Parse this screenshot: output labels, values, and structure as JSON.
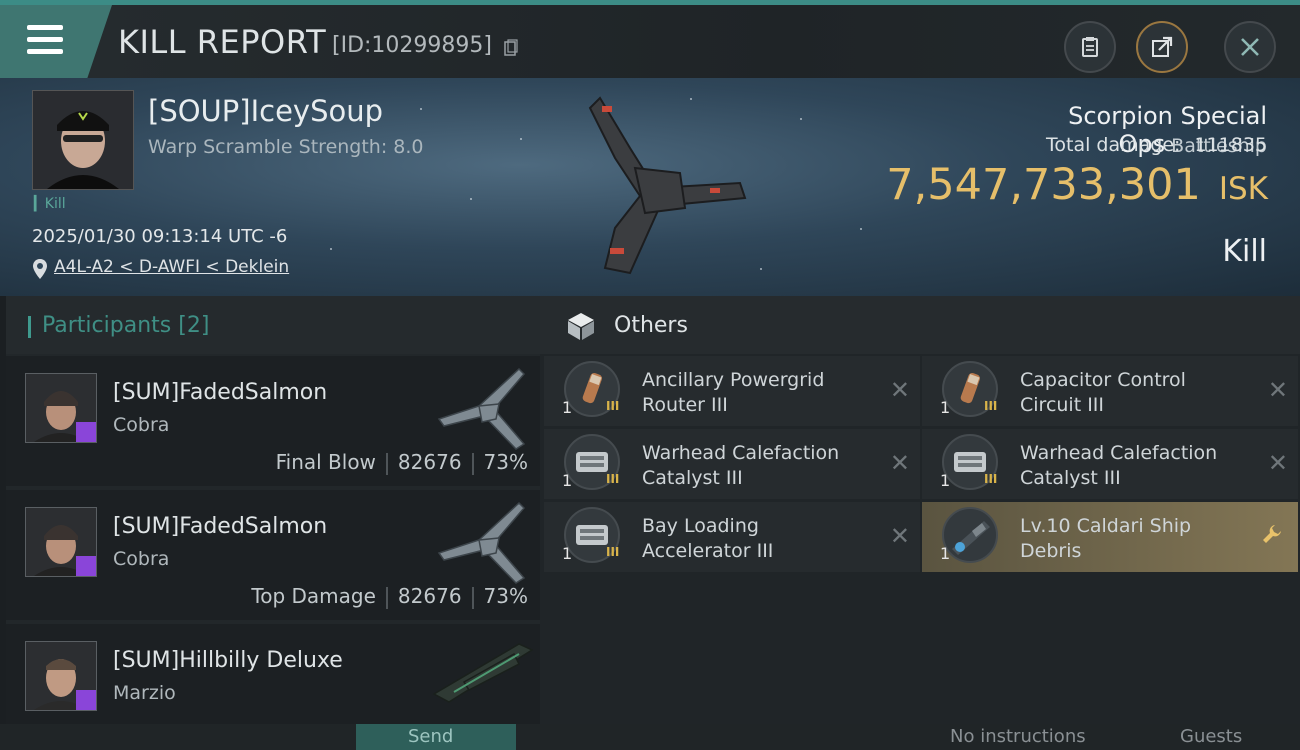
{
  "header": {
    "title": "KILL REPORT",
    "report_id": "[ID:10299895]"
  },
  "victim": {
    "name": "[SOUP]IceySoup",
    "warp_scramble": "Warp Scramble Strength: 8.0",
    "kill_tag": "Kill",
    "timestamp": "2025/01/30 09:13:14 UTC -6",
    "location": "A4L-A2 < D-AWFI < Deklein",
    "ship_name": "Scorpion Special Ops",
    "ship_class": "Battleship",
    "damage_label": "Total damage:",
    "total_damage": "111835",
    "isk_value": "7,547,733,301",
    "isk_unit": "ISK",
    "result": "Kill"
  },
  "participants": {
    "title": "Participants",
    "count": "[2]",
    "rows": [
      {
        "name": "[SUM]FadedSalmon",
        "ship": "Cobra",
        "role": "Final Blow",
        "damage": "82676",
        "percent": "73%"
      },
      {
        "name": "[SUM]FadedSalmon",
        "ship": "Cobra",
        "role": "Top Damage",
        "damage": "82676",
        "percent": "73%"
      },
      {
        "name": "[SUM]Hillbilly Deluxe",
        "ship": "Marzio",
        "role": "",
        "damage": "",
        "percent": ""
      }
    ]
  },
  "others": {
    "title": "Others",
    "items": [
      {
        "name": "Ancillary Powergrid Router III",
        "qty": "1",
        "meta": "III"
      },
      {
        "name": "Capacitor Control Circuit III",
        "qty": "1",
        "meta": "III"
      },
      {
        "name": "Warhead Calefaction Catalyst III",
        "qty": "1",
        "meta": "III"
      },
      {
        "name": "Warhead Calefaction Catalyst III",
        "qty": "1",
        "meta": "III"
      },
      {
        "name": "Bay Loading Accelerator III",
        "qty": "1",
        "meta": "III"
      },
      {
        "name": "Lv.10 Caldari Ship Debris",
        "qty": "1",
        "meta": ""
      }
    ]
  },
  "bottom": {
    "send_label": "Send",
    "instructions": "No instructions",
    "guests": "Guests"
  },
  "colors": {
    "accent_teal": "#3f7671",
    "isk_gold": "#e6bf6a",
    "highlight_item": "#837655",
    "participant_badge": "#8a45d9"
  }
}
